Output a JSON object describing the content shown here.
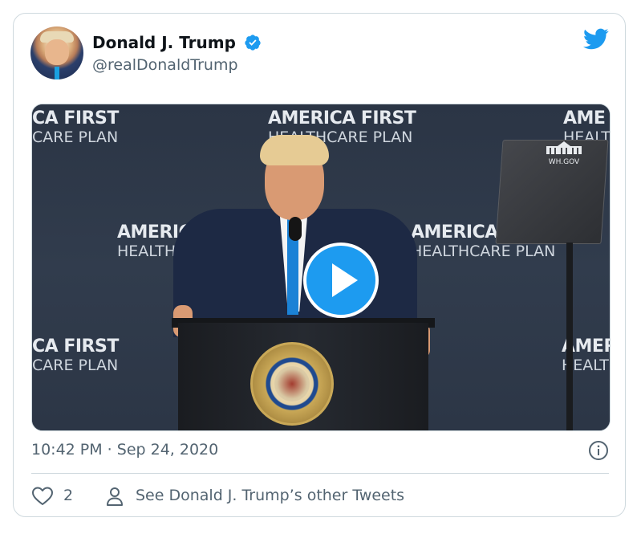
{
  "tweet": {
    "author": {
      "name": "Donald J. Trump",
      "handle": "@realDonaldTrump",
      "verified": true
    },
    "timestamp": "10:42 PM · Sep 24, 2020",
    "likes": "2",
    "see_more": "See Donald J. Trump’s other Tweets"
  },
  "media": {
    "type": "video",
    "backdrop": {
      "line1": "AMERICA FIRST",
      "line2": "HEALTHCARE PLAN",
      "tile_tl_1": "CA FIRST",
      "tile_tl_2": "CARE PLAN",
      "tile_tc_1": "AMERICA FIRST",
      "tile_tc_2": "HEALTHCARE PLAN",
      "tile_tr_1": "AME",
      "tile_tr_2": "HEALT",
      "tile_ml_1": "AMERICA F",
      "tile_ml_2": "HEALTHCAR",
      "tile_mr_1": "AMERICA FIRST",
      "tile_mr_2": "HEALTHCARE PLAN",
      "tile_bl_1": "CA FIRST",
      "tile_bl_2": "CARE PLAN",
      "tile_br_1": "AMER",
      "tile_br_2": "HEALT"
    },
    "teleprompter_logo": "WH.GOV"
  },
  "colors": {
    "brand": "#1d9bf0",
    "text": "#0f1419",
    "muted": "#536471",
    "border": "#cfd9de"
  },
  "icons": [
    "verified-badge-icon",
    "twitter-bird-icon",
    "play-icon",
    "info-icon",
    "heart-icon",
    "person-icon"
  ]
}
